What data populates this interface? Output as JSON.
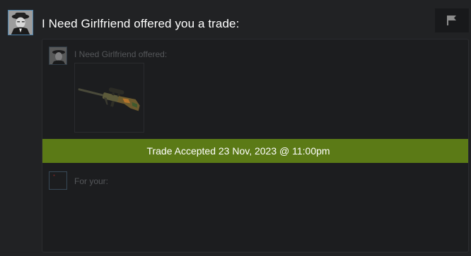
{
  "header": {
    "sender_name": "I Need Girlfriend",
    "headline": "I Need Girlfriend offered you a trade:",
    "report_icon": "flag-icon"
  },
  "trade": {
    "offer_label": "I Need Girlfriend offered:",
    "items_offered": [
      {
        "icon": "sniper-rifle-icon"
      }
    ],
    "status_text": "Trade Accepted 23 Nov, 2023 @ 11:00pm",
    "for_label": "For your:",
    "items_requested": []
  },
  "colors": {
    "background": "#212224",
    "panel": "#1c1d1f",
    "status_green": "#5b7a16",
    "avatar_border": "#4a7fa8"
  }
}
